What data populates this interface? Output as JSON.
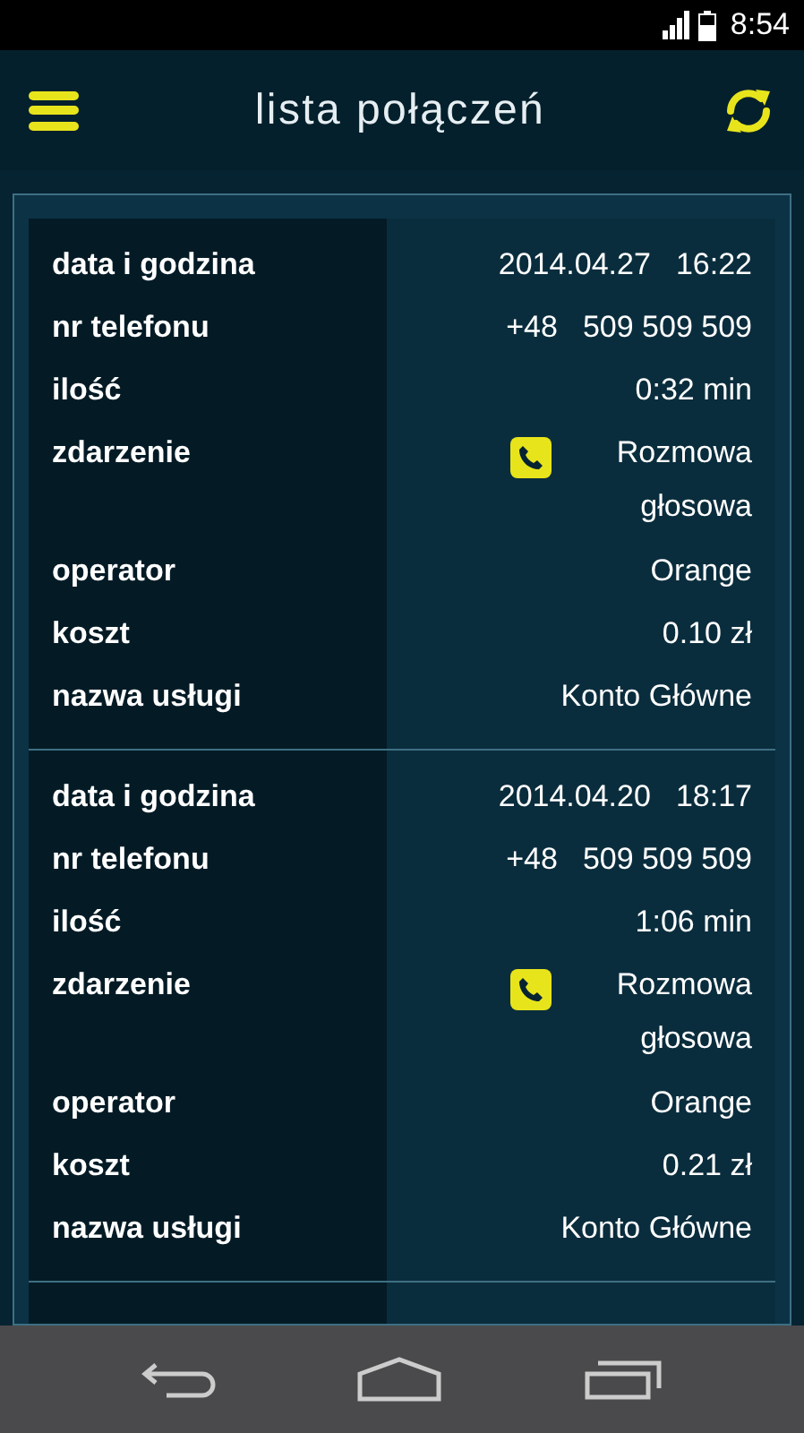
{
  "status_bar": {
    "time": "8:54"
  },
  "header": {
    "title": "lista połączeń"
  },
  "records": [
    {
      "rows": [
        {
          "kind": "text",
          "label": "data i godzina",
          "values": [
            "2014.04.27",
            "16:22"
          ]
        },
        {
          "kind": "text",
          "label": "nr telefonu",
          "values": [
            "+48",
            "509 509 509"
          ]
        },
        {
          "kind": "text",
          "label": "ilość",
          "values": [
            "0:32 min"
          ]
        },
        {
          "kind": "event",
          "label": "zdarzenie",
          "values": [
            "Rozmowa głosowa"
          ]
        },
        {
          "kind": "text",
          "label": "operator",
          "values": [
            "Orange"
          ]
        },
        {
          "kind": "text",
          "label": "koszt",
          "values": [
            "0.10 zł"
          ]
        },
        {
          "kind": "text",
          "label": "nazwa usługi",
          "values": [
            "Konto Główne"
          ]
        }
      ]
    },
    {
      "rows": [
        {
          "kind": "text",
          "label": "data i godzina",
          "values": [
            "2014.04.20",
            "18:17"
          ]
        },
        {
          "kind": "text",
          "label": "nr telefonu",
          "values": [
            "+48",
            "509 509 509"
          ]
        },
        {
          "kind": "text",
          "label": "ilość",
          "values": [
            "1:06 min"
          ]
        },
        {
          "kind": "event",
          "label": "zdarzenie",
          "values": [
            "Rozmowa głosowa"
          ]
        },
        {
          "kind": "text",
          "label": "operator",
          "values": [
            "Orange"
          ]
        },
        {
          "kind": "text",
          "label": "koszt",
          "values": [
            "0.21 zł"
          ]
        },
        {
          "kind": "text",
          "label": "nazwa usługi",
          "values": [
            "Konto Główne"
          ]
        }
      ]
    }
  ]
}
